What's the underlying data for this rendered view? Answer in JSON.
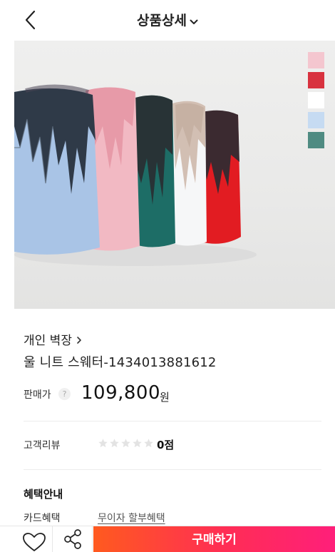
{
  "header": {
    "title": "상품상세"
  },
  "hero": {
    "swatch_colors": [
      "#f4c6cf",
      "#d8323f",
      "#ffffff",
      "#c6dbf2",
      "#4f8b82"
    ]
  },
  "shop": {
    "name": "개인 벽장"
  },
  "product": {
    "title": "울 니트 스웨터-1434013881612"
  },
  "price": {
    "label": "판매가",
    "help": "?",
    "value": "109,800",
    "unit": "원"
  },
  "review": {
    "label": "고객리뷰",
    "rating": 0,
    "max_rating": 5,
    "score": "0점"
  },
  "benefits": {
    "title": "혜택안내",
    "card_label": "카드혜택",
    "card_link": "무이자 할부혜택"
  },
  "bottom_bar": {
    "buy_label": "구매하기"
  },
  "icons": {
    "back": "chevron-left-icon",
    "title_caret": "chevron-down-icon",
    "shop_chevron": "chevron-right-icon",
    "wish": "heart-icon",
    "share": "share-icon",
    "star": "star-icon"
  },
  "colors": {
    "buy_gradient_start": "#ff5a1f",
    "buy_gradient_end": "#ff1f7a",
    "star_inactive": "#e3e3e3"
  }
}
